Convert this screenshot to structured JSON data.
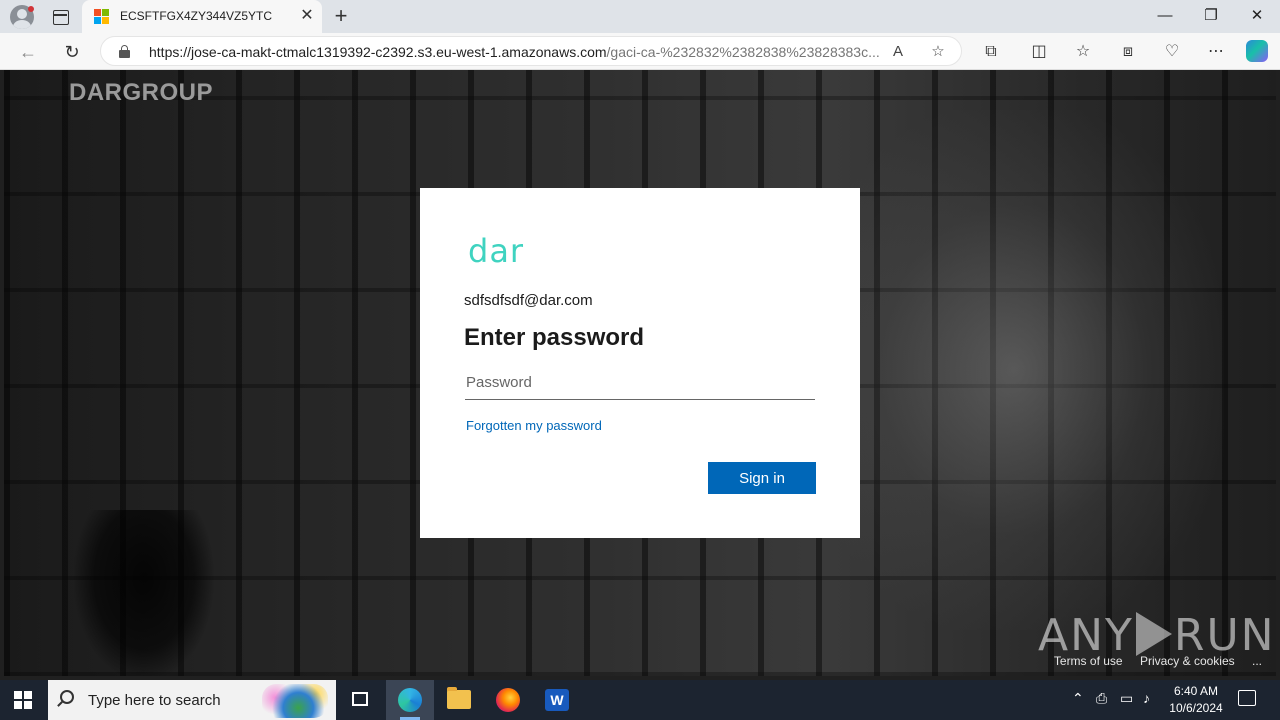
{
  "browser": {
    "tab_title": "ECSFTFGX4ZY344VZ5YTC",
    "tab_close": "✕",
    "new_tab": "+",
    "url_host": "https://jose-ca-makt-ctmalc1319392-c2392.s3.eu-west-1.amazonaws.com",
    "url_path": "/gaci-ca-%232832%2382838%23828383c...",
    "window_controls": {
      "minimize": "—",
      "restore": "❐",
      "close": "✕"
    }
  },
  "page": {
    "brand_bold": "DARGROUP",
    "logo": "dar",
    "identity": "sdfsdfsdf@dar.com",
    "heading": "Enter password",
    "password_placeholder": "Password",
    "forgot_link": "Forgotten my password",
    "signin_label": "Sign in",
    "footer": {
      "terms": "Terms of use",
      "privacy": "Privacy & cookies",
      "more": "..."
    },
    "watermark_left": "ANY",
    "watermark_right": "RUN",
    "accent_color": "#0067b8",
    "logo_color": "#3fd3c0"
  },
  "taskbar": {
    "search_placeholder": "Type here to search",
    "time": "6:40 AM",
    "date": "10/6/2024",
    "tray_chevron": "⌃"
  }
}
